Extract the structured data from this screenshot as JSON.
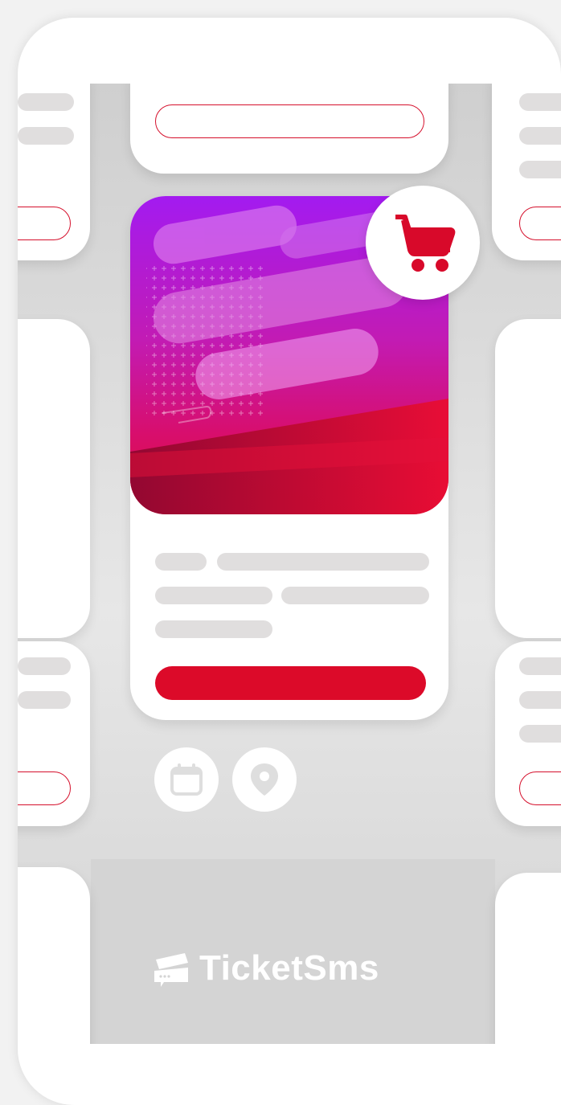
{
  "brand": {
    "name": "TicketSms",
    "icon": "ticket-logo-icon"
  },
  "colors": {
    "accent": "#dc0a29",
    "hero_top": "#a31bf0",
    "hero_bottom": "#e00b3a",
    "placeholder_bar": "#e0dede",
    "background": "#d9d9d9"
  },
  "event_card": {
    "cart_icon": "shopping-cart-icon",
    "buy_button": "primary-action",
    "info_icons": [
      "calendar-icon",
      "location-pin-icon"
    ]
  }
}
